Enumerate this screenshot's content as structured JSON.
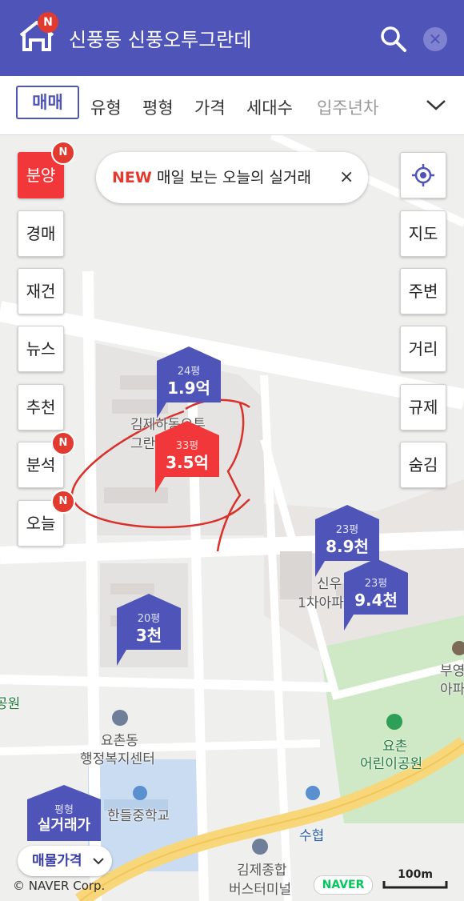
{
  "header": {
    "logo_badge": "N",
    "title": "신풍동 신풍오투그란데",
    "colors": {
      "header_bg": "#4f54b8",
      "accent_red": "#f2373a"
    }
  },
  "filters": [
    {
      "label": "매매"
    },
    {
      "label": "유형"
    },
    {
      "label": "평형"
    },
    {
      "label": "가격"
    },
    {
      "label": "세대수"
    },
    {
      "label": "입주년차"
    }
  ],
  "left_buttons": [
    {
      "label": "분양",
      "badge": "N"
    },
    {
      "label": "경매"
    },
    {
      "label": "재건"
    },
    {
      "label": "뉴스"
    },
    {
      "label": "추천"
    },
    {
      "label": "분석",
      "badge": "N"
    },
    {
      "label": "오늘",
      "badge": "N"
    }
  ],
  "right_buttons": [
    {
      "label": "지도"
    },
    {
      "label": "주변"
    },
    {
      "label": "거리"
    },
    {
      "label": "규제"
    },
    {
      "label": "숨김"
    }
  ],
  "banner": {
    "new_label": "NEW",
    "text": "매일 보는 오늘의 실거래",
    "close": "×"
  },
  "markers": [
    {
      "pyeong": "24평",
      "price": "1.9억"
    },
    {
      "pyeong": "33평",
      "price": "3.5억"
    },
    {
      "pyeong": "23평",
      "price": "8.9천"
    },
    {
      "pyeong": "23평",
      "price": "9.4천"
    },
    {
      "pyeong": "20평",
      "price": "3천"
    },
    {
      "pyeong": "평형",
      "price": "실거래가"
    }
  ],
  "map_labels": {
    "complex_line1": "김제하동오투",
    "complex_line2": "그란",
    "apt_line1": "신우",
    "apt_line2": "1차아파",
    "office_line1": "요촌동",
    "office_line2": "행정복지센터",
    "school": "한들중학교",
    "park_line1": "요촌",
    "park_line2": "어린이공원",
    "bank": "수협",
    "terminal_line1": "김제종합",
    "terminal_line2": "버스터미널",
    "edge_right1": "부영",
    "edge_right2": "아파",
    "edge_left": "공원"
  },
  "footer": {
    "price_type": "매물가격",
    "copyright": "© NAVER Corp.",
    "naver": "NAVER",
    "scale": "100m"
  }
}
